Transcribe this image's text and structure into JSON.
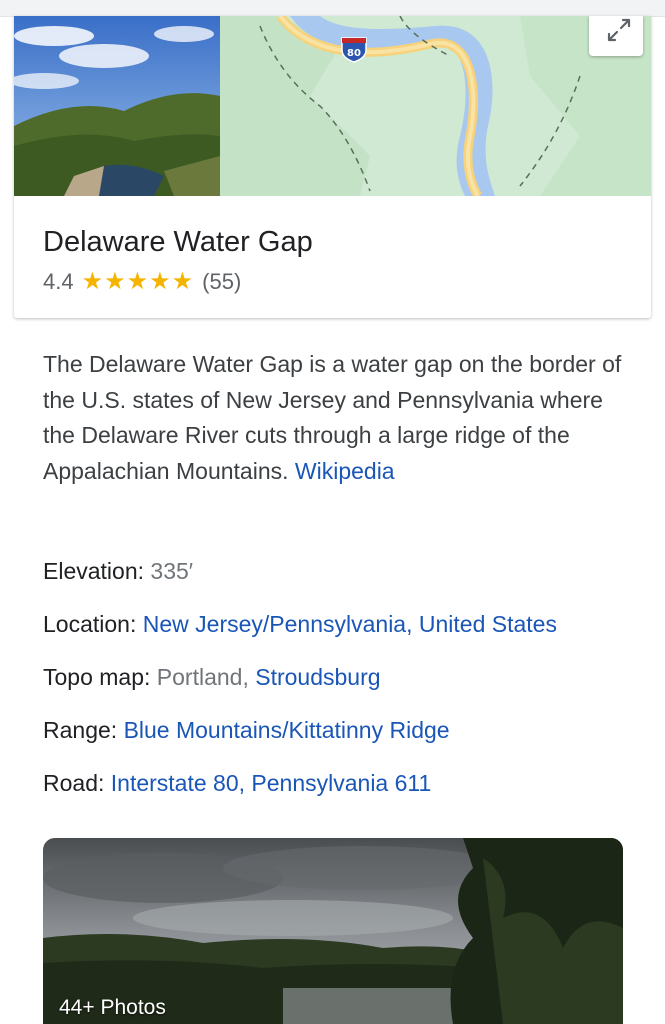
{
  "map": {
    "shield_number": "80"
  },
  "place": {
    "title": "Delaware Water Gap",
    "rating": "4.4",
    "stars": "★★★★★",
    "review_count": "(55)"
  },
  "description": {
    "text": "The Delaware Water Gap is a water gap on the border of the U.S. states of New Jersey and Pennsylvania where the Delaware River cuts through a large ridge of the Appalachian Mountains. ",
    "source_link": "Wikipedia"
  },
  "facts": {
    "elevation": {
      "label": "Elevation: ",
      "value": "335′"
    },
    "location": {
      "label": "Location: ",
      "link1": "New Jersey/Pennsylvania",
      "sep": ", ",
      "link2": "United States"
    },
    "topo": {
      "label": "Topo map: ",
      "value": "Portland, ",
      "link": "Stroudsburg"
    },
    "range": {
      "label": "Range: ",
      "link": "Blue Mountains/Kittatinny Ridge"
    },
    "road": {
      "label": "Road: ",
      "link": "Interstate 80, Pennsylvania 611"
    }
  },
  "photos": {
    "label": "44+ Photos"
  },
  "colors": {
    "link": "#1a56b7",
    "star": "#f4b400",
    "map_green": "#cde8cf",
    "river": "#a9c8f0"
  }
}
